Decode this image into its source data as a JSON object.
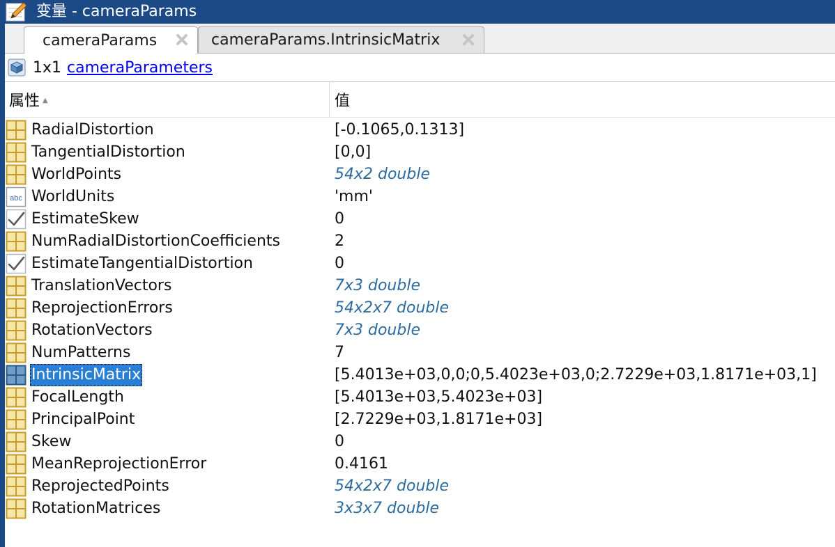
{
  "window": {
    "title": "变量 - cameraParams"
  },
  "tabs": [
    {
      "label": "cameraParams",
      "active": true
    },
    {
      "label": "cameraParams.IntrinsicMatrix",
      "active": false
    }
  ],
  "infobar": {
    "size": "1x1",
    "class_name": "cameraParameters"
  },
  "table": {
    "header_property": "属性",
    "header_value": "值",
    "rows": [
      {
        "name": "RadialDistortion",
        "value": "[-0.1065,0.1313]",
        "icon": "grid-icon",
        "kind": "text"
      },
      {
        "name": "TangentialDistortion",
        "value": "[0,0]",
        "icon": "grid-icon",
        "kind": "text"
      },
      {
        "name": "WorldPoints",
        "value": "54x2 double",
        "icon": "grid-icon",
        "kind": "array"
      },
      {
        "name": "WorldUnits",
        "value": "'mm'",
        "icon": "abc-icon",
        "kind": "text"
      },
      {
        "name": "EstimateSkew",
        "value": "0",
        "icon": "check-icon",
        "kind": "text"
      },
      {
        "name": "NumRadialDistortionCoefficients",
        "value": "2",
        "icon": "grid-icon",
        "kind": "text"
      },
      {
        "name": "EstimateTangentialDistortion",
        "value": "0",
        "icon": "check-icon",
        "kind": "text"
      },
      {
        "name": "TranslationVectors",
        "value": "7x3 double",
        "icon": "grid-icon",
        "kind": "array"
      },
      {
        "name": "ReprojectionErrors",
        "value": "54x2x7 double",
        "icon": "grid-icon",
        "kind": "array"
      },
      {
        "name": "RotationVectors",
        "value": "7x3 double",
        "icon": "grid-icon",
        "kind": "array"
      },
      {
        "name": "NumPatterns",
        "value": "7",
        "icon": "grid-icon",
        "kind": "text"
      },
      {
        "name": "IntrinsicMatrix",
        "value": "[5.4013e+03,0,0;0,5.4023e+03,0;2.7229e+03,1.8171e+03,1]",
        "icon": "grid-icon-selected",
        "kind": "text",
        "selected": true
      },
      {
        "name": "FocalLength",
        "value": "[5.4013e+03,5.4023e+03]",
        "icon": "grid-icon",
        "kind": "text"
      },
      {
        "name": "PrincipalPoint",
        "value": "[2.7229e+03,1.8171e+03]",
        "icon": "grid-icon",
        "kind": "text"
      },
      {
        "name": "Skew",
        "value": "0",
        "icon": "grid-icon",
        "kind": "text"
      },
      {
        "name": "MeanReprojectionError",
        "value": "0.4161",
        "icon": "grid-icon",
        "kind": "text"
      },
      {
        "name": "ReprojectedPoints",
        "value": "54x2x7 double",
        "icon": "grid-icon",
        "kind": "array"
      },
      {
        "name": "RotationMatrices",
        "value": "3x3x7 double",
        "icon": "grid-icon",
        "kind": "array"
      }
    ]
  },
  "colors": {
    "titlebar": "#1c4a86",
    "selection": "#2a7fd4",
    "array_text": "#2d6b9e",
    "link": "#0000ee",
    "grid_icon_fill": "#f7e7a6",
    "grid_icon_stroke": "#c89b2a"
  }
}
